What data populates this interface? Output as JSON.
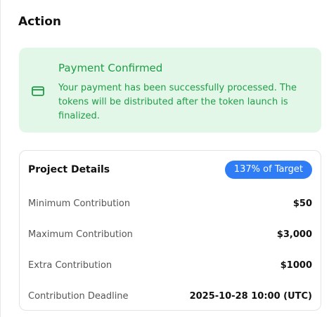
{
  "section": {
    "title": "Action"
  },
  "alert": {
    "icon": "credit-card-icon",
    "title": "Payment Confirmed",
    "message": "Your payment has been successfully processed. The tokens will be distributed after the token launch is finalized.",
    "color": "#1f9d47",
    "background": "#e3f7e8"
  },
  "project": {
    "title": "Project Details",
    "badge": "137% of Target",
    "badge_color": "#2f7df6",
    "rows": [
      {
        "label": "Minimum Contribution",
        "value": "$50"
      },
      {
        "label": "Maximum Contribution",
        "value": "$3,000"
      },
      {
        "label": "Extra Contribution",
        "value": "$1000"
      },
      {
        "label": "Contribution Deadline",
        "value": "2025-10-28 10:00 (UTC)"
      }
    ]
  }
}
